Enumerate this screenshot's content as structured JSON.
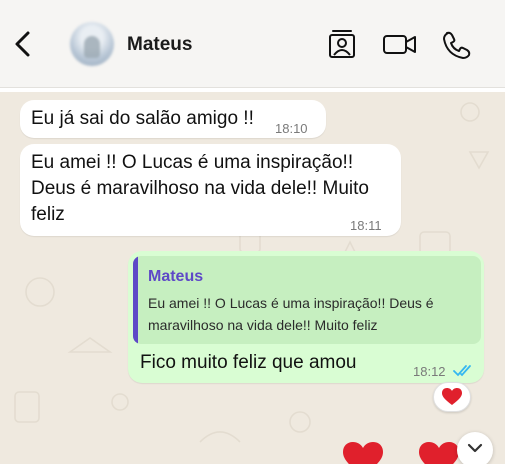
{
  "header": {
    "contact_name": "Mateus"
  },
  "messages": [
    {
      "direction": "in",
      "text": "Eu já sai do salão amigo !!",
      "time": "18:10"
    },
    {
      "direction": "in",
      "text": "Eu amei !! O Lucas é uma inspiração!! Deus é maravilhoso na vida dele!! Muito feliz",
      "time": "18:11"
    },
    {
      "direction": "out",
      "quoted": {
        "author": "Mateus",
        "text": "Eu amei !! O Lucas é uma inspiração!! Deus é maravilhoso na vida dele!! Muito feliz"
      },
      "text": "Fico muito feliz que amou",
      "time": "18:12",
      "status": "read",
      "reaction": "❤️"
    }
  ],
  "colors": {
    "header_bg": "#f6f5f3",
    "chat_bg": "#efe9df",
    "outgoing_bubble": "#d9fdd3",
    "quote_accent": "#5e48c7",
    "read_ticks": "#34b7f1",
    "heart": "#e0202c"
  },
  "icons": [
    "back-chevron-icon",
    "contact-card-icon",
    "video-call-icon",
    "phone-icon",
    "double-check-icon",
    "chevron-down-icon",
    "heart-icon"
  ]
}
